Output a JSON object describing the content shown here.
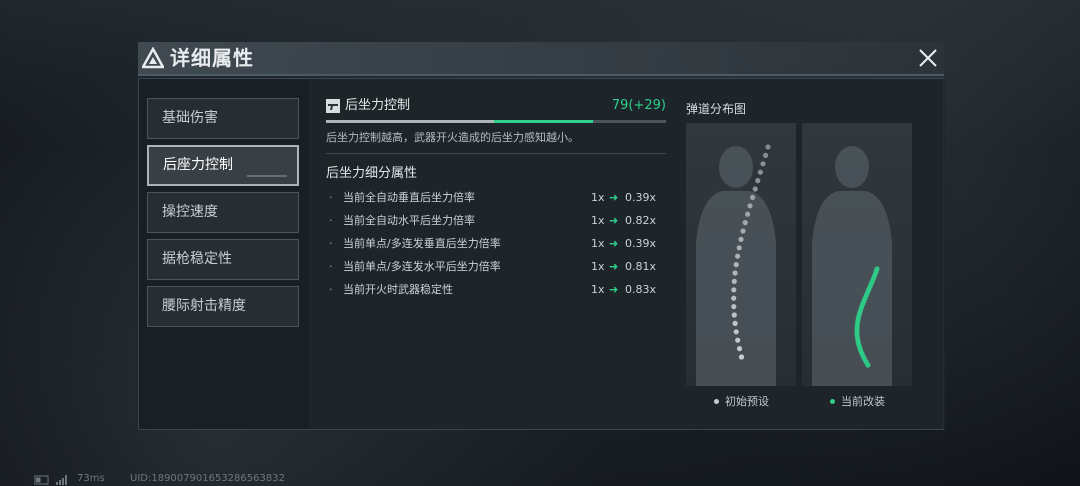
{
  "title": "详细属性",
  "tabs": [
    {
      "label": "基础伤害",
      "active": false
    },
    {
      "label": "后座力控制",
      "active": true
    },
    {
      "label": "操控速度",
      "active": false
    },
    {
      "label": "据枪稳定性",
      "active": false
    },
    {
      "label": "腰际射击精度",
      "active": false
    }
  ],
  "attribute": {
    "name": "后坐力控制",
    "value": "79(+29)",
    "base_fraction": 0.495,
    "bonus_fraction": 0.29,
    "description": "后坐力控制越高，武器开火造成的后坐力感知越小。"
  },
  "breakdown": {
    "title": "后坐力细分属性",
    "rows": [
      {
        "label": "当前全自动垂直后坐力倍率",
        "base": "1x",
        "new": "0.39x"
      },
      {
        "label": "当前全自动水平后坐力倍率",
        "base": "1x",
        "new": "0.82x"
      },
      {
        "label": "当前单点/多连发垂直后坐力倍率",
        "base": "1x",
        "new": "0.39x"
      },
      {
        "label": "当前单点/多连发水平后坐力倍率",
        "base": "1x",
        "new": "0.81x"
      },
      {
        "label": "当前开火时武器稳定性",
        "base": "1x",
        "new": "0.83x"
      }
    ]
  },
  "spread": {
    "title": "弹道分布图",
    "legend_initial": "初始预设",
    "legend_current": "当前改装",
    "color_initial": "#c8cdd0",
    "color_current": "#2ed08a"
  },
  "footer": {
    "ping": "73ms",
    "uid": "UID:18900790165328656383​2"
  },
  "colors": {
    "accent_green": "#2ed08a"
  }
}
